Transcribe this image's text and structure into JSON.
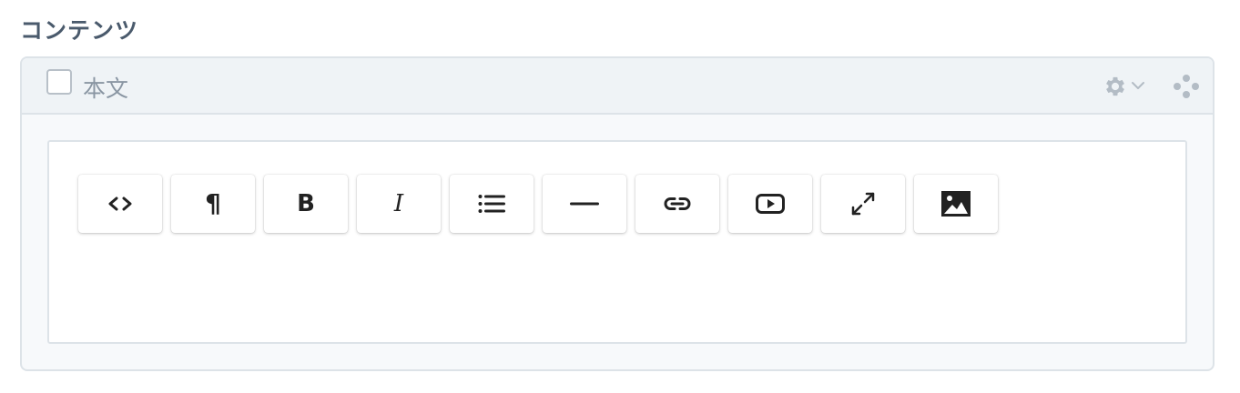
{
  "section": {
    "title": "コンテンツ"
  },
  "field": {
    "label": "本文",
    "checked": false
  },
  "toolbar": {
    "buttons": [
      {
        "name": "html-source-button",
        "icon": "code-icon"
      },
      {
        "name": "paragraph-button",
        "icon": "pilcrow-icon",
        "glyph": "¶"
      },
      {
        "name": "bold-button",
        "icon": "bold-icon",
        "glyph": "B"
      },
      {
        "name": "italic-button",
        "icon": "italic-icon",
        "glyph": "I"
      },
      {
        "name": "list-button",
        "icon": "list-icon"
      },
      {
        "name": "horizontal-rule-button",
        "icon": "horizontal-rule-icon"
      },
      {
        "name": "link-button",
        "icon": "link-icon"
      },
      {
        "name": "video-button",
        "icon": "video-play-icon"
      },
      {
        "name": "fullscreen-button",
        "icon": "expand-icon"
      },
      {
        "name": "image-button",
        "icon": "image-icon"
      }
    ]
  },
  "colors": {
    "title": "#4a5a6c",
    "label": "#8a96a3",
    "border": "#dde3e8",
    "header_bg": "#eff3f6",
    "icon": "#222222",
    "muted_icon": "#b3bcc5"
  }
}
